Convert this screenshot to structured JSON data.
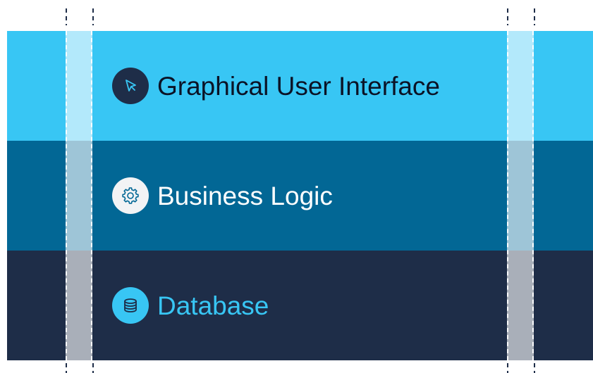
{
  "colors": {
    "gui_layer": "#38C6F4",
    "business_layer": "#026795",
    "database_layer": "#1E2D48",
    "gui_text": "#0B1326",
    "business_text": "#FFFFFF",
    "database_text": "#38C6F4",
    "gui_badge_bg": "#1E2D48",
    "gui_badge_icon": "#38C6F4",
    "business_badge_bg": "#F2F3F5",
    "business_badge_icon": "#026795",
    "database_badge_bg": "#38C6F4",
    "database_badge_icon": "#1E2D48",
    "tick": "#1E2D48"
  },
  "layers": [
    {
      "id": "gui",
      "label": "Graphical User Interface",
      "icon": "cursor-arrow-icon"
    },
    {
      "id": "business",
      "label": "Business Logic",
      "icon": "gear-icon"
    },
    {
      "id": "database",
      "label": "Database",
      "icon": "database-icon"
    }
  ]
}
